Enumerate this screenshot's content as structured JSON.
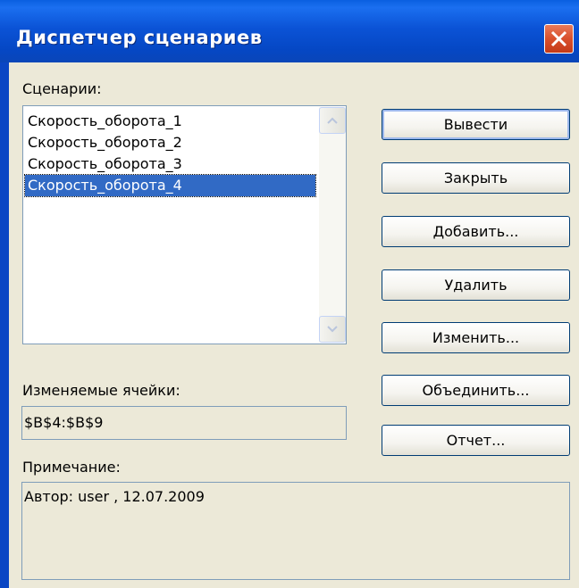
{
  "window": {
    "title": "Диспетчер сценариев"
  },
  "scenarios": {
    "label": "Сценарии:",
    "items": [
      "Скорость_оборота_1",
      "Скорость_оборота_2",
      "Скорость_оборота_3",
      "Скорость_оборота_4"
    ],
    "selected_index": 3
  },
  "buttons": {
    "show": "Вывести",
    "close": "Закрыть",
    "add": "Добавить...",
    "delete": "Удалить",
    "edit": "Изменить...",
    "merge": "Объединить...",
    "report": "Отчет..."
  },
  "changing_cells": {
    "label": "Изменяемые ячейки:",
    "value": "$B$4:$B$9"
  },
  "comment": {
    "label": "Примечание:",
    "value": "Автор: user , 12.07.2009"
  },
  "icons": {
    "close": "close-icon",
    "scroll_up": "chevron-up-icon",
    "scroll_down": "chevron-down-icon"
  },
  "colors": {
    "titlebar": "#0b53d6",
    "selection": "#316ac5",
    "dialog_bg": "#ece9d8",
    "close_button": "#d9502c"
  }
}
